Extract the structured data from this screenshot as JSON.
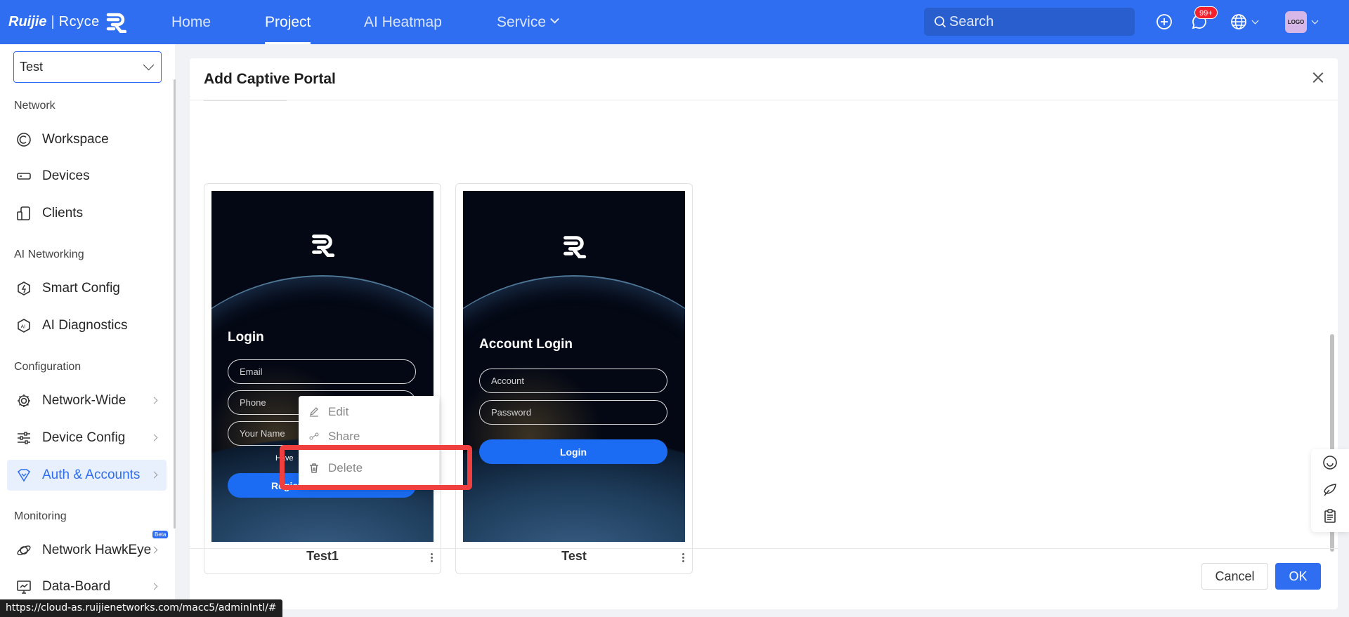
{
  "brand": {
    "name": "Ruijie",
    "sub": "Rcyce"
  },
  "nav": [
    {
      "label": "Home"
    },
    {
      "label": "Project",
      "active": true
    },
    {
      "label": "AI Heatmap"
    },
    {
      "label": "Service"
    }
  ],
  "search": {
    "placeholder": "Search"
  },
  "notifications": {
    "badge": "99+"
  },
  "avatar": {
    "text": "LOGO"
  },
  "sidebar": {
    "project": "Test",
    "groups": {
      "network": "Network",
      "ai": "AI Networking",
      "config": "Configuration",
      "monitoring": "Monitoring"
    },
    "items": {
      "workspace": "Workspace",
      "devices": "Devices",
      "clients": "Clients",
      "smart_config": "Smart Config",
      "ai_diagnostics": "AI Diagnostics",
      "network_wide": "Network-Wide",
      "device_config": "Device Config",
      "auth_accounts": "Auth & Accounts",
      "hawkeye": "Network HawkEye",
      "hawkeye_badge": "Beta",
      "data_board": "Data-Board"
    }
  },
  "modal": {
    "title": "Add Captive Portal",
    "cancel": "Cancel",
    "ok": "OK"
  },
  "cards": [
    {
      "name": "Test1",
      "portal_title": "Login",
      "fields": [
        "Email",
        "Phone",
        "Your Name"
      ],
      "small_text": "Have",
      "button": "Regist"
    },
    {
      "name": "Test",
      "portal_title": "Account Login",
      "fields": [
        "Account",
        "Password"
      ],
      "button": "Login"
    }
  ],
  "context_menu": {
    "edit": "Edit",
    "share": "Share",
    "delete": "Delete"
  },
  "status_url": "https://cloud-as.ruijienetworks.com/macc5/adminIntl/#",
  "colors": {
    "primary": "#2f6ef0",
    "highlight": "#ef3f3f",
    "badge": "#f5222d"
  }
}
